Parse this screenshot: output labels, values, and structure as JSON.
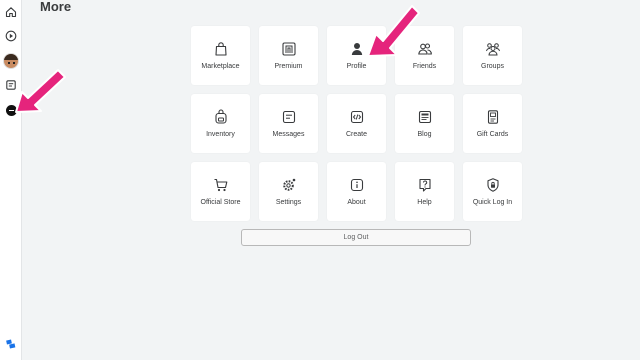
{
  "page": {
    "title": "More"
  },
  "colors": {
    "accent_arrow": "#e5247c",
    "tile_bg": "#ffffff",
    "page_bg": "#f2f4f5"
  },
  "sidebar": {
    "items": [
      {
        "icon": "home-icon"
      },
      {
        "icon": "discover-icon"
      },
      {
        "icon": "avatar"
      },
      {
        "icon": "chat-icon"
      },
      {
        "icon": "more-icon"
      },
      {
        "icon": "roblox-logo-icon"
      }
    ]
  },
  "menu": {
    "tiles": [
      {
        "label": "Marketplace",
        "icon": "shopping-bag-icon"
      },
      {
        "label": "Premium",
        "icon": "premium-icon"
      },
      {
        "label": "Profile",
        "icon": "profile-icon"
      },
      {
        "label": "Friends",
        "icon": "friends-icon"
      },
      {
        "label": "Groups",
        "icon": "groups-icon"
      },
      {
        "label": "Inventory",
        "icon": "backpack-icon"
      },
      {
        "label": "Messages",
        "icon": "messages-icon"
      },
      {
        "label": "Create",
        "icon": "code-icon"
      },
      {
        "label": "Blog",
        "icon": "blog-icon"
      },
      {
        "label": "Gift Cards",
        "icon": "gift-card-icon"
      },
      {
        "label": "Official Store",
        "icon": "cart-icon"
      },
      {
        "label": "Settings",
        "icon": "gear-icon"
      },
      {
        "label": "About",
        "icon": "info-icon"
      },
      {
        "label": "Help",
        "icon": "help-icon"
      },
      {
        "label": "Quick Log In",
        "icon": "shield-lock-icon"
      }
    ],
    "logout_label": "Log Out"
  }
}
